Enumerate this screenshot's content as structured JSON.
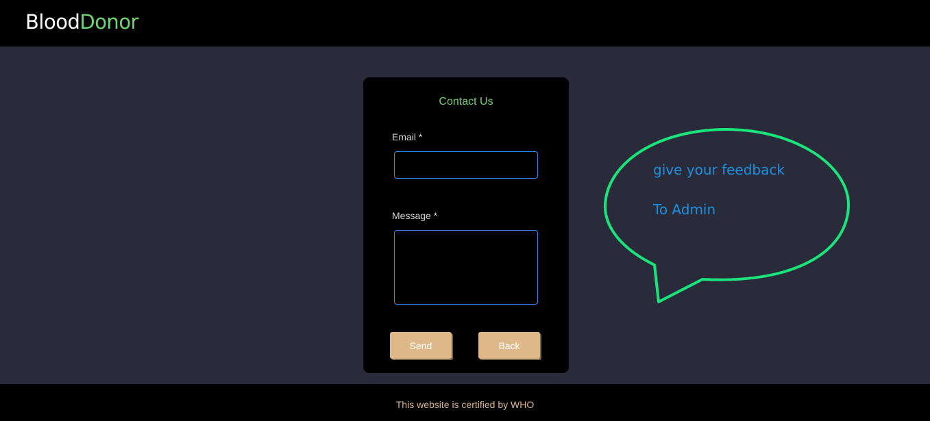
{
  "navbar": {
    "brand_part1": "Blood",
    "brand_part2": "Donor"
  },
  "contact_form": {
    "title": "Contact Us",
    "email_label": "Email *",
    "email_value": "",
    "message_label": "Message *",
    "message_value": "",
    "send_label": "Send",
    "back_label": "Back"
  },
  "callout": {
    "line1": "give your feedback",
    "line2": "To Admin"
  },
  "footer": {
    "text": "This website is certified by WHO"
  },
  "colors": {
    "background": "#292b3a",
    "bar": "#000000",
    "brand_accent": "#6ed66e",
    "button": "#dfb88a",
    "input_border": "#3b82f6",
    "bubble_stroke": "#19e57a",
    "bubble_text": "#1e90e0"
  }
}
